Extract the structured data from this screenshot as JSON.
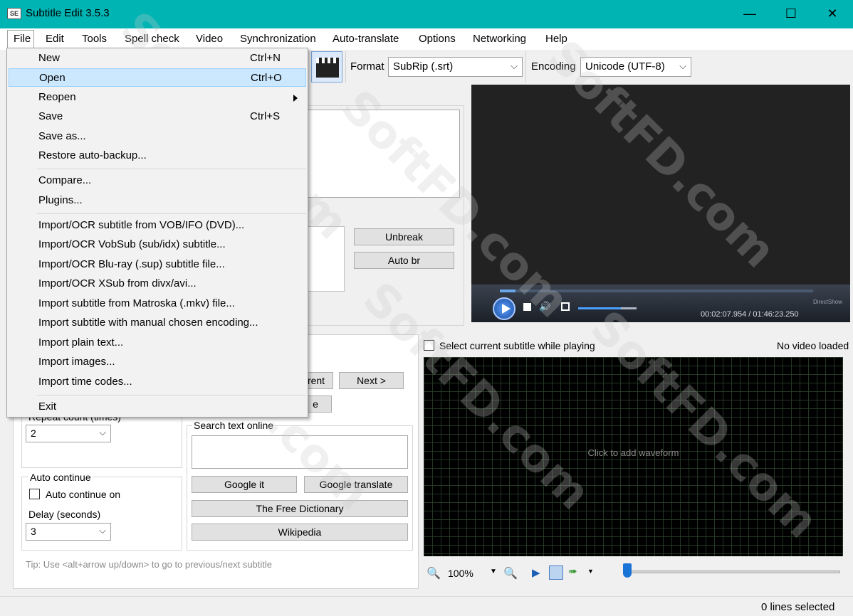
{
  "window": {
    "title": "Subtitle Edit 3.5.3",
    "app_icon_text": "SE",
    "controls": {
      "minimize": "—",
      "maximize": "☐",
      "close": "✕"
    }
  },
  "menubar": {
    "items": [
      "File",
      "Edit",
      "Tools",
      "Spell check",
      "Video",
      "Synchronization",
      "Auto-translate",
      "Options",
      "Networking",
      "Help"
    ]
  },
  "toolbar": {
    "format_label": "Format",
    "format_value": "SubRip (.srt)",
    "encoding_label": "Encoding",
    "encoding_value": "Unicode (UTF-8)"
  },
  "file_menu": {
    "items": [
      {
        "label": "New",
        "shortcut": "Ctrl+N"
      },
      {
        "label": "Open",
        "shortcut": "Ctrl+O",
        "highlighted": true
      },
      {
        "label": "Reopen",
        "submenu": true
      },
      {
        "label": "Save",
        "shortcut": "Ctrl+S"
      },
      {
        "label": "Save as..."
      },
      {
        "label": "Restore auto-backup..."
      },
      {
        "label": "Compare..."
      },
      {
        "label": "Plugins..."
      },
      {
        "label": "Import/OCR subtitle from VOB/IFO (DVD)..."
      },
      {
        "label": "Import/OCR VobSub (sub/idx) subtitle..."
      },
      {
        "label": "Import/OCR Blu-ray (.sup) subtitle file..."
      },
      {
        "label": "Import/OCR XSub from divx/avi..."
      },
      {
        "label": "Import subtitle from Matroska (.mkv) file..."
      },
      {
        "label": "Import subtitle with manual chosen encoding..."
      },
      {
        "label": "Import plain text..."
      },
      {
        "label": "Import images..."
      },
      {
        "label": "Import time codes..."
      },
      {
        "label": "Exit"
      }
    ]
  },
  "edit_panel": {
    "unbreak": "Unbreak",
    "auto_br": "Auto br"
  },
  "translate_panel": {
    "current_partial": "rent",
    "next": "Next >",
    "partial_e": "e",
    "repeat_count_label": "Repeat count (times)",
    "repeat_count_value": "2",
    "auto_continue_title": "Auto continue",
    "auto_continue_on": "Auto continue on",
    "delay_label": "Delay (seconds)",
    "delay_value": "3",
    "search_text_online": "Search text online",
    "google_it": "Google it",
    "google_translate": "Google translate",
    "free_dictionary": "The Free Dictionary",
    "wikipedia": "Wikipedia",
    "tip": "Tip: Use <alt+arrow up/down> to go to previous/next subtitle"
  },
  "video": {
    "time": "00:02:07.954 / 01:46:23.250",
    "renderer": "DirectShow",
    "progress": 0.05,
    "volume": 0.73
  },
  "waveform": {
    "select_current_label": "Select current subtitle while playing",
    "no_video": "No video loaded",
    "click_to_add": "Click to add waveform",
    "zoom": "100%",
    "position": 0.01
  },
  "status": {
    "lines_selected": "0 lines selected"
  },
  "watermark": "SoftFD.com"
}
